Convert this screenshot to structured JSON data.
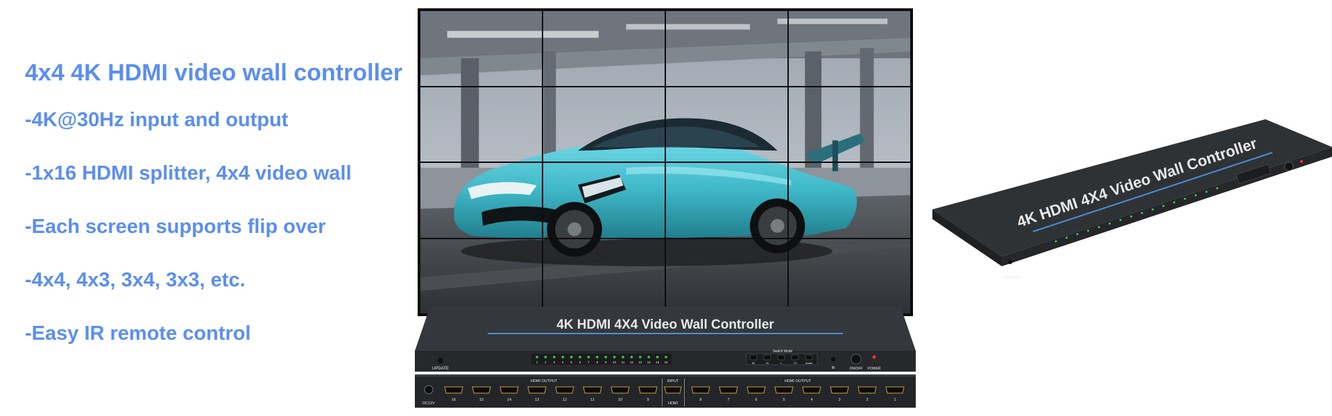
{
  "headline": "4x4 4K HDMI video wall controller",
  "features": [
    "-4K@30Hz input and output",
    "-1x16 HDMI splitter, 4x4 video wall",
    "-Each screen supports flip over",
    "-4x4, 4x3, 3x4, 3x3, etc.",
    "-Easy IR remote control"
  ],
  "device": {
    "title": "4K HDMI 4X4 Video Wall Controller",
    "update_label": "UPDATE",
    "switch_mode_label": "Switch Mode",
    "mode_keys": [
      "MI",
      "M",
      "L",
      "TX",
      "Audio"
    ],
    "ir_label": "IR",
    "onoff_label": "ON/OFF",
    "power_label": "POWER",
    "dc_label": "DC12V",
    "hdmi_output_label": "HDMI OUTPUT",
    "input_label": "INPUT",
    "hdmi_label": "HDMI",
    "led_numbers": [
      "1",
      "2",
      "3",
      "4",
      "5",
      "6",
      "7",
      "8",
      "9",
      "10",
      "11",
      "12",
      "13",
      "14",
      "15",
      "16"
    ],
    "left_port_numbers": [
      "16",
      "15",
      "14",
      "13",
      "12",
      "11",
      "10",
      "9"
    ],
    "right_port_numbers": [
      "8",
      "7",
      "6",
      "5",
      "4",
      "3",
      "2",
      "1"
    ]
  },
  "colors": {
    "text_accent": "#5b8ef0",
    "device_body": "#2b2d30",
    "title_underline": "#4a8fd8",
    "car_body": "#3fb8c8",
    "led_green": "#3ad04a",
    "power_led": "#ff3030"
  }
}
